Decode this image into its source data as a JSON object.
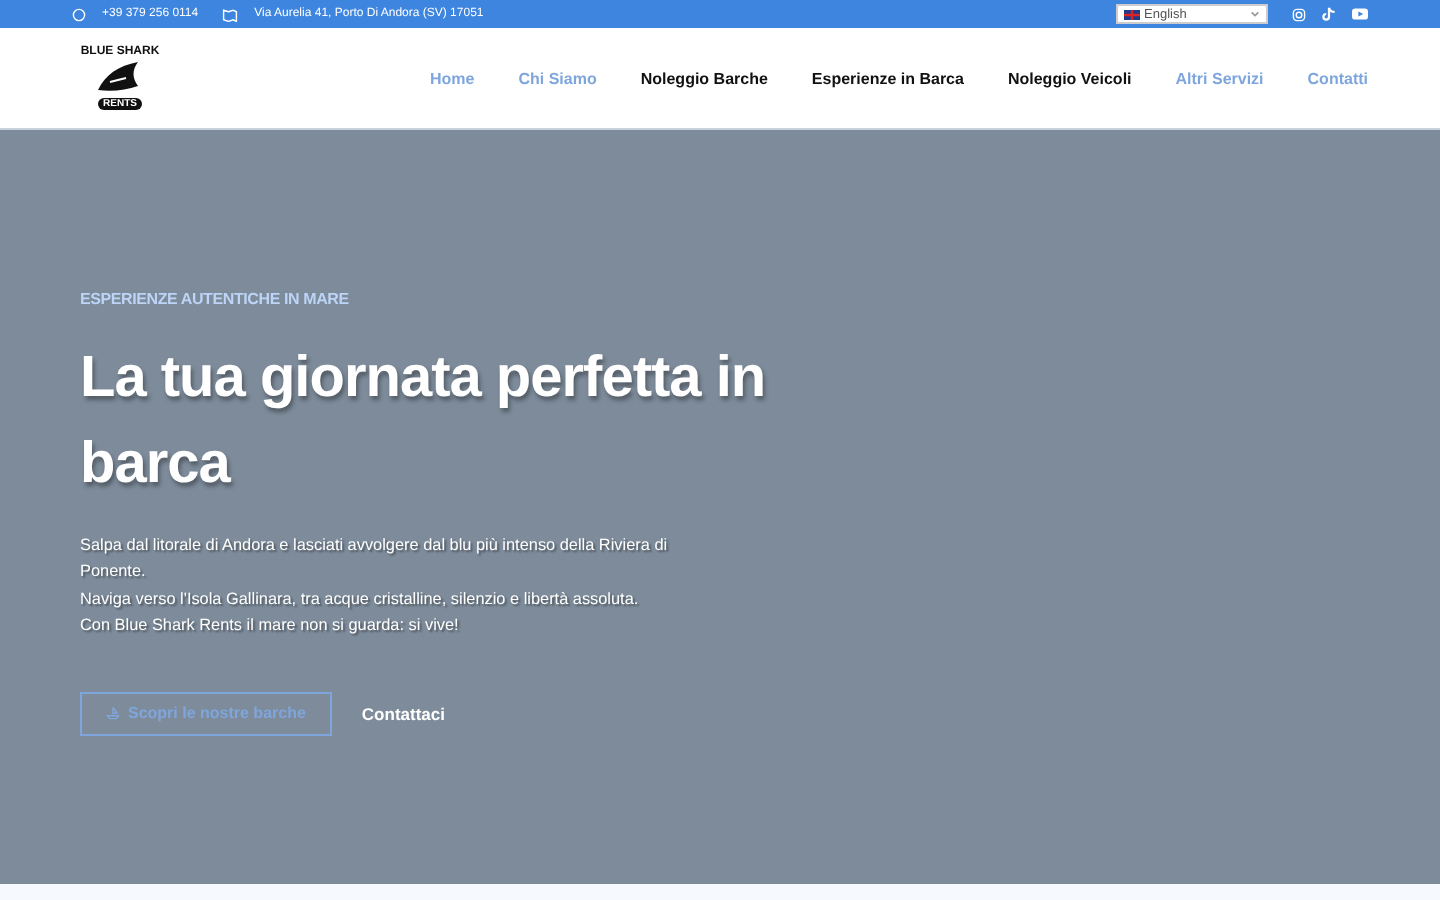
{
  "topbar": {
    "phone": "+39 379 256 0114",
    "address": "Via Aurelia 41, Porto Di Andora (SV) 17051",
    "language": "English"
  },
  "logo": {
    "line1": "BLUE SHARK",
    "line2": "RENTS"
  },
  "nav": [
    {
      "label": "Home",
      "kind": "accent"
    },
    {
      "label": "Chi Siamo",
      "kind": "accent"
    },
    {
      "label": "Noleggio Barche",
      "kind": "plain"
    },
    {
      "label": "Esperienze in Barca",
      "kind": "plain"
    },
    {
      "label": "Noleggio Veicoli",
      "kind": "plain"
    },
    {
      "label": "Altri Servizi",
      "kind": "accent"
    },
    {
      "label": "Contatti",
      "kind": "accent"
    }
  ],
  "hero": {
    "eyebrow": "ESPERIENZE AUTENTICHE IN MARE",
    "title": "La tua giornata perfetta in barca",
    "paragraphs": [
      "Salpa dal litorale di Andora e lasciati avvolgere dal blu più intenso della Riviera di Ponente.",
      "Naviga verso l'Isola Gallinara, tra acque cristalline, silenzio e libertà assoluta.",
      "Con Blue Shark Rents il mare non si guarda: si vive!"
    ],
    "primary_button": "Scopri le nostre barche",
    "secondary_button": "Contattaci"
  }
}
